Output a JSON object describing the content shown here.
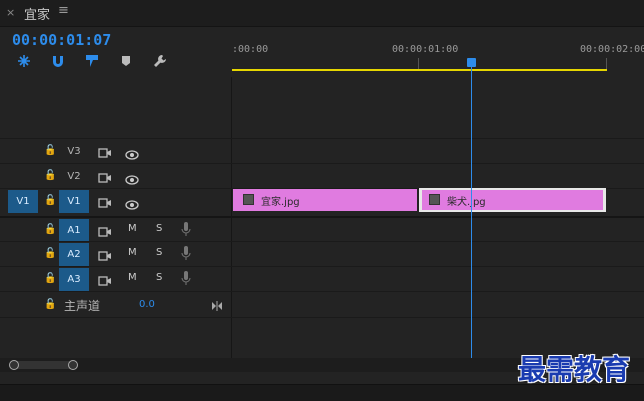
{
  "panel": {
    "close_glyph": "×",
    "title": "宜家",
    "menu_glyph": "≡"
  },
  "timecode": "00:00:01:07",
  "toolbar": {
    "icons": [
      "snap-icon",
      "magnet-icon",
      "linked-selection-icon",
      "marker-icon",
      "wrench-icon"
    ]
  },
  "ruler": {
    "labels": [
      ":00:00",
      "00:00:01:00",
      "00:00:02:00"
    ]
  },
  "video_tracks": [
    {
      "name": "V3",
      "source": ""
    },
    {
      "name": "V2",
      "source": ""
    },
    {
      "name": "V1",
      "source": "V1"
    }
  ],
  "audio_tracks": [
    {
      "name": "A1",
      "m": "M",
      "s": "S"
    },
    {
      "name": "A2",
      "m": "M",
      "s": "S"
    },
    {
      "name": "A3",
      "m": "M",
      "s": "S"
    }
  ],
  "master": {
    "label": "主声道",
    "value": "0.0"
  },
  "clips": [
    {
      "name": "宜家.jpg"
    },
    {
      "name": "柴犬.jpg"
    }
  ],
  "watermark": "最需教育",
  "colors": {
    "accent": "#2d8ceb",
    "clip": "#e07be0",
    "work_area": "#e6d600",
    "track_active": "#1c5a8a"
  }
}
